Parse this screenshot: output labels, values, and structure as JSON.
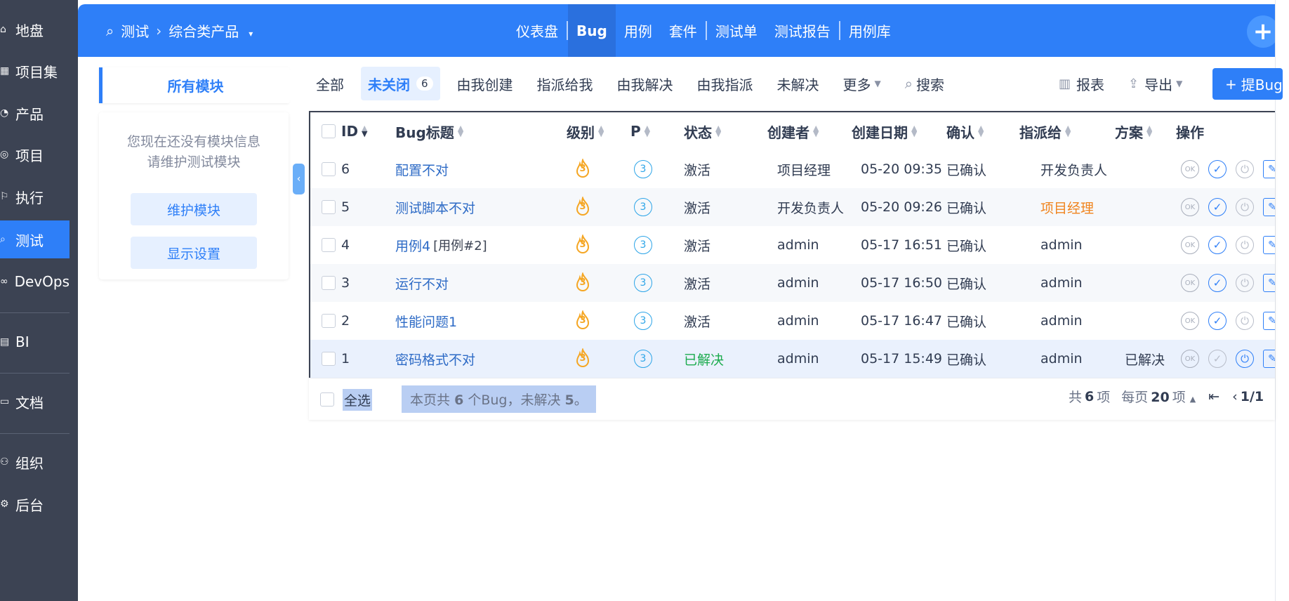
{
  "sidebar": {
    "items": [
      {
        "label": "地盘",
        "icon": "home-icon"
      },
      {
        "label": "项目集",
        "icon": "grid-icon"
      },
      {
        "label": "产品",
        "icon": "lightbulb-icon"
      },
      {
        "label": "项目",
        "icon": "folder-icon"
      },
      {
        "label": "执行",
        "icon": "run-icon"
      },
      {
        "label": "测试",
        "icon": "search-icon"
      },
      {
        "label": "DevOps",
        "icon": "infinity-icon"
      },
      {
        "label": "BI",
        "icon": "chart-icon"
      },
      {
        "label": "文档",
        "icon": "doc-icon"
      },
      {
        "label": "组织",
        "icon": "org-icon"
      },
      {
        "label": "后台",
        "icon": "gear-icon"
      }
    ],
    "active": "测试"
  },
  "header": {
    "crumb_root": "测试",
    "crumb_product": "综合类产品",
    "nav": [
      "仪表盘",
      "Bug",
      "用例",
      "套件",
      "测试单",
      "测试报告",
      "用例库"
    ],
    "nav_active": "Bug"
  },
  "module": {
    "tab_label": "所有模块",
    "msg_line1": "您现在还没有模块信息",
    "msg_line2": "请维护测试模块",
    "btn_maintain": "维护模块",
    "btn_display": "显示设置"
  },
  "filters": {
    "all": "全部",
    "unclosed": "未关闭",
    "unclosed_count": "6",
    "created_by_me": "由我创建",
    "assigned_to_me": "指派给我",
    "resolved_by_me": "由我解决",
    "assigned_by_me": "由我指派",
    "unresolved": "未解决",
    "more": "更多",
    "search": "搜索",
    "report": "报表",
    "export": "导出",
    "submit_bug": "提Bug"
  },
  "table": {
    "headers": {
      "id": "ID",
      "title": "Bug标题",
      "severity": "级别",
      "pri": "P",
      "status": "状态",
      "creator": "创建者",
      "date": "创建日期",
      "confirm": "确认",
      "assigned": "指派给",
      "resolution": "方案",
      "actions": "操作"
    },
    "rows": [
      {
        "id": "6",
        "title": "配置不对",
        "tag": "",
        "severity": "3",
        "pri": "3",
        "status": "激活",
        "creator": "项目经理",
        "date": "05-20 09:35",
        "confirm": "已确认",
        "assigned": "开发负责人",
        "resolution": ""
      },
      {
        "id": "5",
        "title": "测试脚本不对",
        "tag": "",
        "severity": "3",
        "pri": "3",
        "status": "激活",
        "creator": "开发负责人",
        "date": "05-20 09:26",
        "confirm": "已确认",
        "assigned": "项目经理",
        "resolution": ""
      },
      {
        "id": "4",
        "title": "用例4",
        "tag": "[用例#2]",
        "severity": "3",
        "pri": "3",
        "status": "激活",
        "creator": "admin",
        "date": "05-17 16:51",
        "confirm": "已确认",
        "assigned": "admin",
        "resolution": ""
      },
      {
        "id": "3",
        "title": "运行不对",
        "tag": "",
        "severity": "3",
        "pri": "3",
        "status": "激活",
        "creator": "admin",
        "date": "05-17 16:50",
        "confirm": "已确认",
        "assigned": "admin",
        "resolution": ""
      },
      {
        "id": "2",
        "title": "性能问题1",
        "tag": "",
        "severity": "3",
        "pri": "3",
        "status": "激活",
        "creator": "admin",
        "date": "05-17 16:47",
        "confirm": "已确认",
        "assigned": "admin",
        "resolution": ""
      },
      {
        "id": "1",
        "title": "密码格式不对",
        "tag": "",
        "severity": "3",
        "pri": "3",
        "status": "已解决",
        "creator": "admin",
        "date": "05-17 15:49",
        "confirm": "已确认",
        "assigned": "admin",
        "resolution": "已解决"
      }
    ]
  },
  "footer": {
    "select_all": "全选",
    "summary_prefix": "本页共",
    "summary_count": "6",
    "summary_mid": "个Bug，未解决",
    "summary_unresolved": "5",
    "summary_suffix": "。",
    "total_prefix": "共",
    "total": "6",
    "total_suffix": "项",
    "per_page_prefix": "每页",
    "per_page": "20",
    "per_page_suffix": "项",
    "page": "1/1"
  },
  "colors": {
    "primary": "#2e7ff8",
    "sidebar": "#3c4353",
    "resolved": "#1cab4e",
    "highlight": "#f0841e",
    "severity": "#f5a623"
  }
}
